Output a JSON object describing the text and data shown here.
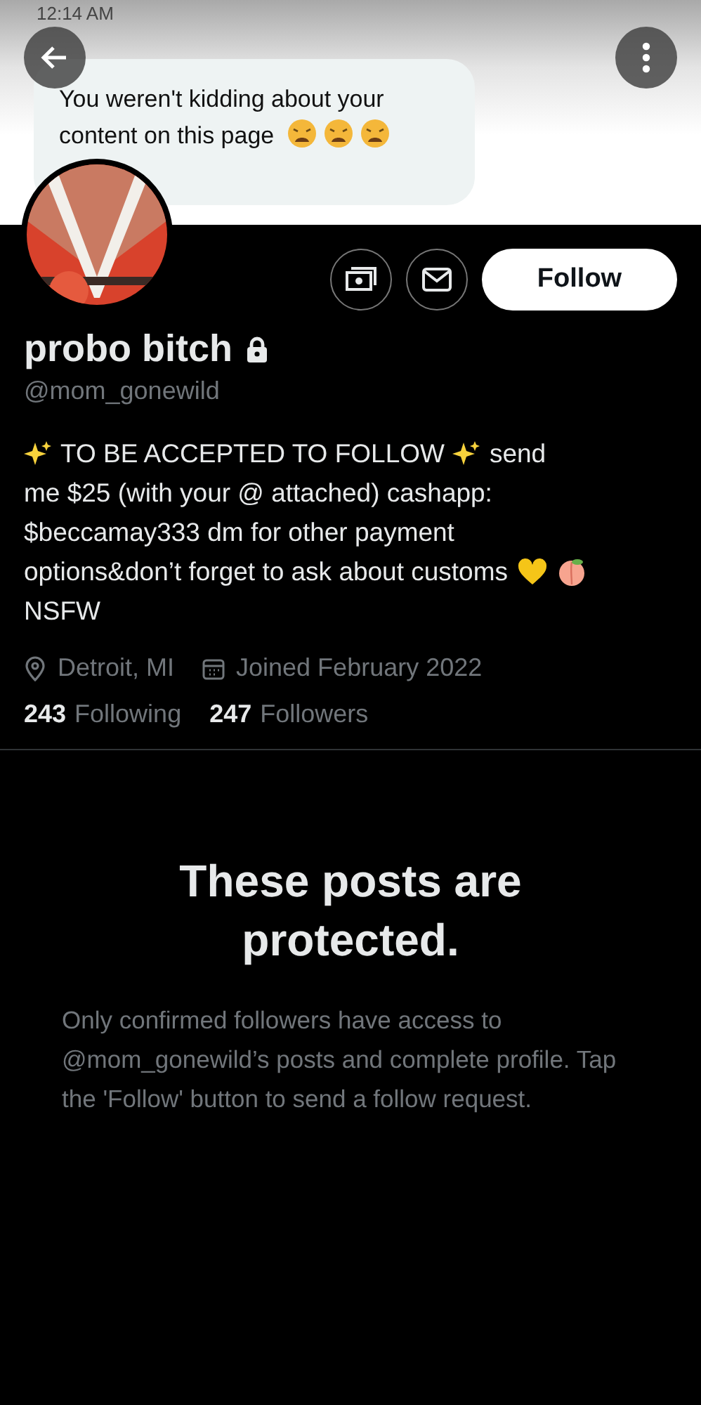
{
  "banner": {
    "time": "12:14 AM",
    "message": "You weren't kidding about your content on this page"
  },
  "actions": {
    "follow": "Follow"
  },
  "profile": {
    "name": "probo bitch",
    "locked": true,
    "handle": "@mom_gonewild",
    "bio": [
      [
        {
          "kind": "sparkle"
        },
        {
          "kind": "text",
          "text": "TO BE ACCEPTED TO FOLLOW"
        },
        {
          "kind": "sparkle"
        },
        {
          "kind": "text",
          "text": "send"
        }
      ],
      [
        {
          "kind": "text",
          "text": "me $25 (with your @ attached) cashapp:"
        }
      ],
      [
        {
          "kind": "text",
          "text": "$beccamay333 dm for other payment"
        }
      ],
      [
        {
          "kind": "text",
          "text": "options&don’t forget to ask about customs"
        },
        {
          "kind": "heart"
        },
        {
          "kind": "peach"
        }
      ],
      [
        {
          "kind": "text",
          "text": "NSFW"
        }
      ]
    ],
    "location": "Detroit, MI",
    "joined": "Joined February 2022",
    "following_count": "243",
    "following_label": "Following",
    "followers_count": "247",
    "followers_label": "Followers"
  },
  "protected": {
    "title": "These posts are protected.",
    "body": "Only confirmed followers have access to @mom_gonewild’s posts and complete profile. Tap the 'Follow' button to send a follow request."
  }
}
